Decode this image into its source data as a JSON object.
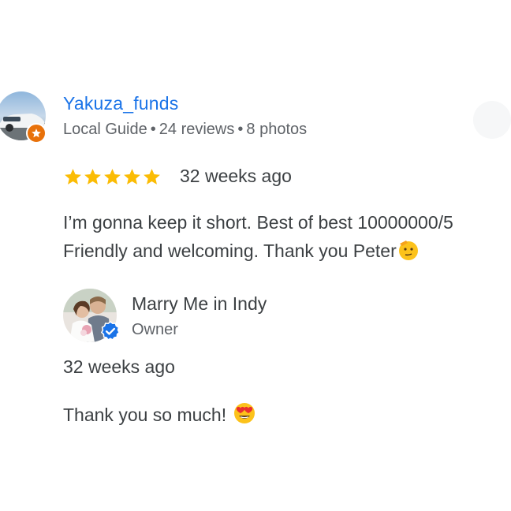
{
  "review": {
    "reviewer_name": "Yakuza_funds",
    "reviewer_badge": "Local Guide",
    "review_count": "24 reviews",
    "photo_count": "8 photos",
    "separator": "•",
    "rating": 5,
    "rating_max": 5,
    "date": "32 weeks ago",
    "text_line1": "I’m gonna keep it short. Best of best 10000000/5",
    "text_line2": "Friendly and welcoming. Thank you Peter"
  },
  "response": {
    "owner_name": "Marry Me in Indy",
    "owner_role": "Owner",
    "date": "32 weeks ago",
    "text": "Thank you so much!"
  },
  "colors": {
    "name_link": "#1a73e8",
    "star": "#fbbc04",
    "local_guide_badge": "#e8710a",
    "verified_badge": "#1a73e8",
    "secondary_text": "#5f6368"
  },
  "icons": {
    "reviewer_avatar": "car-photo-avatar",
    "local_guide": "local-guide-star-icon",
    "star": "star-icon",
    "emoji_1": "salute-face-emoji",
    "owner_avatar": "couple-photo-avatar",
    "verified": "verified-check-icon",
    "emoji_2": "heart-eyes-emoji"
  }
}
